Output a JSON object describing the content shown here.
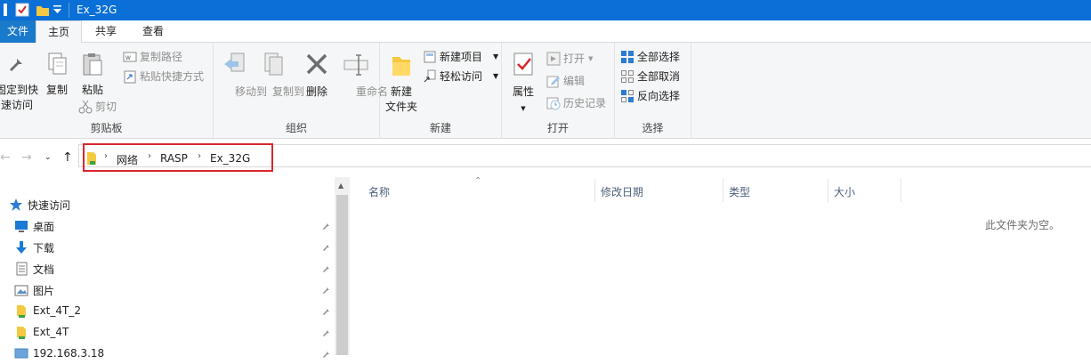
{
  "window": {
    "title": "Ex_32G"
  },
  "tabs": [
    {
      "label": "文件"
    },
    {
      "label": "主页"
    },
    {
      "label": "共享"
    },
    {
      "label": "查看"
    }
  ],
  "ribbon": {
    "clipboard": {
      "label": "剪贴板",
      "pin_quick_access": "固定到快\n速访问",
      "pin_line1": "固定到快",
      "pin_line2": "速访问",
      "copy": "复制",
      "paste": "粘贴",
      "copy_path": "复制路径",
      "paste_shortcut": "粘贴快捷方式",
      "cut": "剪切"
    },
    "organize": {
      "label": "组织",
      "move_to": "移动到",
      "copy_to": "复制到",
      "delete": "删除",
      "rename": "重命名"
    },
    "new": {
      "label": "新建",
      "new_folder_line1": "新建",
      "new_folder_line2": "文件夹",
      "new_item": "新建项目",
      "easy_access": "轻松访问"
    },
    "open": {
      "label": "打开",
      "properties": "属性",
      "open": "打开",
      "edit": "编辑",
      "history": "历史记录"
    },
    "select": {
      "label": "选择",
      "select_all": "全部选择",
      "select_none": "全部取消",
      "invert": "反向选择"
    }
  },
  "address": {
    "crumbs": [
      "网络",
      "RASP",
      "Ex_32G"
    ]
  },
  "nav": {
    "quick_access": "快速访问",
    "items": [
      {
        "label": "桌面",
        "icon": "desktop-icon"
      },
      {
        "label": "下载",
        "icon": "download-icon"
      },
      {
        "label": "文档",
        "icon": "document-icon"
      },
      {
        "label": "图片",
        "icon": "picture-icon"
      },
      {
        "label": "Ext_4T_2",
        "icon": "network-folder-icon"
      },
      {
        "label": "Ext_4T",
        "icon": "network-folder-icon"
      },
      {
        "label": "192.168.3.18",
        "icon": "computer-icon"
      }
    ]
  },
  "content": {
    "columns": [
      "名称",
      "修改日期",
      "类型",
      "大小"
    ],
    "empty_message": "此文件夹为空。"
  },
  "colors": {
    "titlebar": "#0a6fd6",
    "file_tab": "#1979ca",
    "highlight_box": "#d9262c"
  }
}
